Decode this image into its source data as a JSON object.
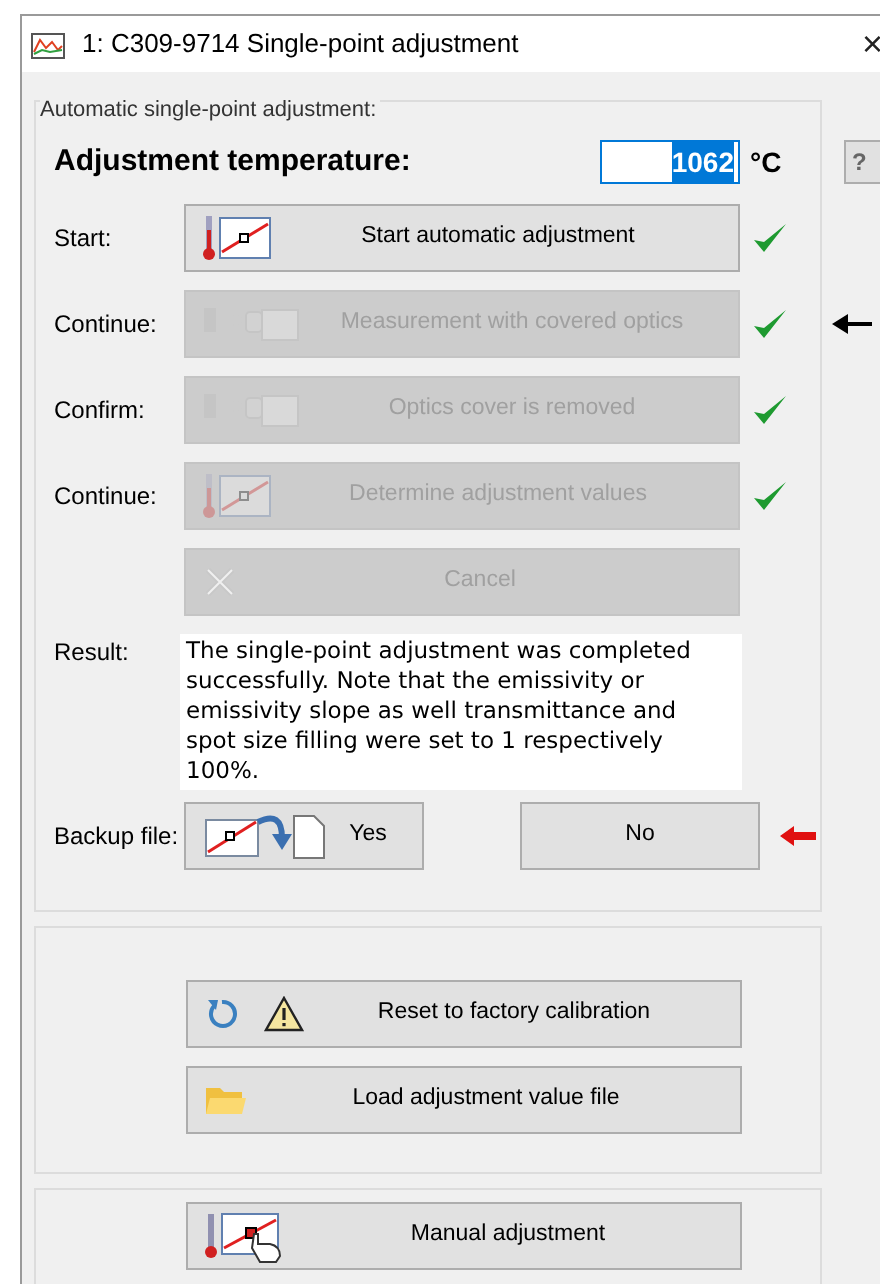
{
  "window": {
    "title": "1: C309-9714 Single-point adjustment",
    "close": "×"
  },
  "auto_group": {
    "title": "Automatic single-point adjustment:",
    "temperature_label": "Adjustment temperature:",
    "temperature_value": "1062",
    "temperature_selected": true,
    "unit": "°C",
    "steps": [
      {
        "label": "Start:",
        "button": "Start automatic adjustment",
        "kind": "thermo",
        "disabled": false,
        "done": true,
        "arrow": false
      },
      {
        "label": "Continue:",
        "button": "Measurement with covered optics",
        "kind": "optics",
        "disabled": true,
        "done": true,
        "arrow": true
      },
      {
        "label": "Confirm:",
        "button": "Optics cover is removed",
        "kind": "optics",
        "disabled": true,
        "done": true,
        "arrow": false
      },
      {
        "label": "Continue:",
        "button": "Determine adjustment values",
        "kind": "thermo",
        "disabled": true,
        "done": true,
        "arrow": false
      },
      {
        "button": "Cancel",
        "kind": "cancel",
        "disabled": true,
        "done": false,
        "arrow": false
      }
    ],
    "result_label": "Result:",
    "result_text": "The single-point adjustment was completed successfully. Note that the emissivity or emissivity slope as well transmittance and spot size filling were set to 1 respectively 100%.",
    "backup_label": "Backup file:",
    "backup_buttons": [
      {
        "label": "Yes",
        "kind": "backup",
        "arrow": false
      },
      {
        "label": "No",
        "kind": "plain",
        "arrow": true
      }
    ]
  },
  "calibration_group": {
    "buttons": [
      {
        "label": "Reset to factory calibration",
        "kind": "reset"
      },
      {
        "label": "Load adjustment value file",
        "kind": "folder"
      }
    ]
  },
  "manual_group": {
    "buttons": [
      {
        "label": "Manual adjustment",
        "kind": "manual"
      }
    ]
  },
  "help_button": "?"
}
